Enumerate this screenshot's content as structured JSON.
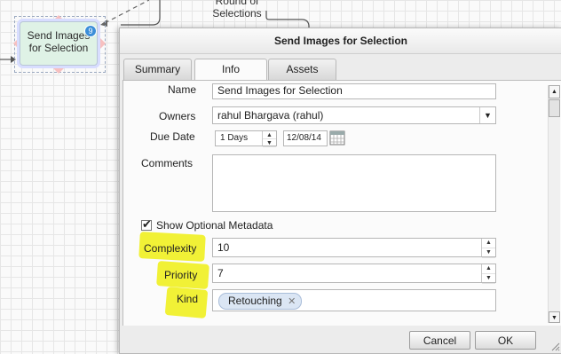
{
  "canvas": {
    "node_label": "Send Images for Selection",
    "round_label": "Round of Selections",
    "node_badge": "9"
  },
  "dialog": {
    "title": "Send Images for Selection",
    "tabs": [
      {
        "label": "Summary",
        "active": false
      },
      {
        "label": "Info",
        "active": true
      },
      {
        "label": "Assets",
        "active": false
      }
    ],
    "fields": {
      "name_label": "Name",
      "name_value": "Send Images for Selection",
      "owners_label": "Owners",
      "owners_value": "rahul Bhargava (rahul)",
      "due_date_label": "Due Date",
      "due_days_value": "1 Days",
      "due_date_value": "12/08/14",
      "comments_label": "Comments",
      "comments_value": "",
      "show_optional_label": "Show Optional Metadata",
      "show_optional_checked": true,
      "complexity_label": "Complexity",
      "complexity_value": "10",
      "priority_label": "Priority",
      "priority_value": "7",
      "kind_label": "Kind",
      "kind_tag": "Retouching"
    },
    "buttons": {
      "cancel": "Cancel",
      "ok": "OK"
    }
  },
  "colors": {
    "highlight": "#f0f020",
    "node_fill": "#dff2e6",
    "tag_fill": "#dbe6f4"
  }
}
